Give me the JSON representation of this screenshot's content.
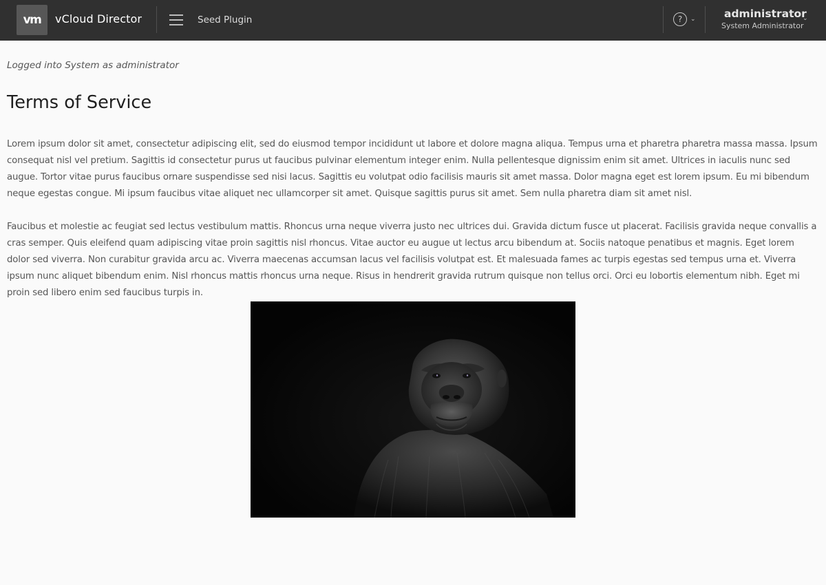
{
  "header": {
    "logo_text": "vm",
    "app_title": "vCloud Director",
    "menu_icon": "hamburger-menu-icon",
    "plugin_link": "Seed Plugin",
    "help_icon": "help-circle-icon",
    "help_glyph": "?",
    "caret_glyph": "⌄",
    "user": {
      "name": "administrator",
      "role": "System Administrator"
    }
  },
  "content": {
    "login_note": "Logged into System as administrator",
    "title": "Terms of Service",
    "paragraphs": [
      "Lorem ipsum dolor sit amet, consectetur adipiscing elit, sed do eiusmod tempor incididunt ut labore et dolore magna aliqua. Tempus urna et pharetra pharetra massa massa. Ipsum consequat nisl vel pretium. Sagittis id consectetur purus ut faucibus pulvinar elementum integer enim. Nulla pellentesque dignissim enim sit amet. Ultrices in iaculis nunc sed augue. Tortor vitae purus faucibus ornare suspendisse sed nisi lacus. Sagittis eu volutpat odio facilisis mauris sit amet massa. Dolor magna eget est lorem ipsum. Eu mi bibendum neque egestas congue. Mi ipsum faucibus vitae aliquet nec ullamcorper sit amet. Quisque sagittis purus sit amet. Sem nulla pharetra diam sit amet nisl.",
      "Faucibus et molestie ac feugiat sed lectus vestibulum mattis. Rhoncus urna neque viverra justo nec ultrices dui. Gravida dictum fusce ut placerat. Facilisis gravida neque convallis a cras semper. Quis eleifend quam adipiscing vitae proin sagittis nisl rhoncus. Vitae auctor eu augue ut lectus arcu bibendum at. Sociis natoque penatibus et magnis. Eget lorem dolor sed viverra. Non curabitur gravida arcu ac. Viverra maecenas accumsan lacus vel facilisis volutpat est. Et malesuada fames ac turpis egestas sed tempus urna et. Viverra ipsum nunc aliquet bibendum enim. Nisl rhoncus mattis rhoncus urna neque. Risus in hendrerit gravida rutrum quisque non tellus orci. Orci eu lobortis elementum nibh. Eget mi proin sed libero enim sed faucibus turpis in."
    ],
    "image_subject": "gorilla-photo"
  },
  "colors": {
    "header_bg": "#303030",
    "page_bg": "#fafafa",
    "title": "#1f1f1f",
    "body_text": "#565656"
  }
}
